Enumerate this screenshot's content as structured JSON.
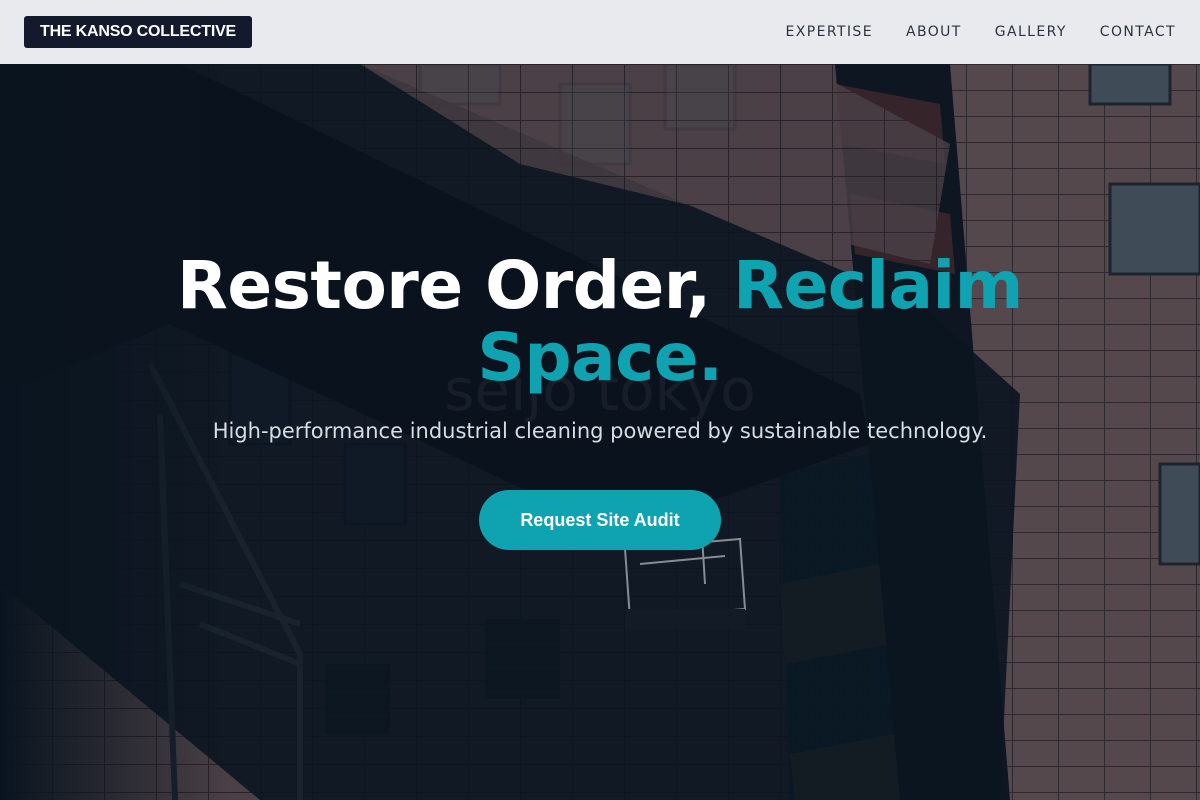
{
  "header": {
    "logo": "THE KANSO COLLECTIVE",
    "nav": [
      {
        "label": "EXPERTISE"
      },
      {
        "label": "ABOUT"
      },
      {
        "label": "GALLERY"
      },
      {
        "label": "CONTACT"
      }
    ]
  },
  "hero": {
    "headline_part1": "Restore Order,",
    "headline_accent": "Reclaim Space.",
    "subheadline": "High-performance industrial cleaning powered by sustainable technology.",
    "cta_label": "Request Site Audit",
    "background_sign_text": "seijo tokyo"
  },
  "colors": {
    "accent": "#0fa3b1",
    "logo_bg": "#121a2c",
    "header_bg": "#f0f2f4",
    "nav_text": "#2b3440"
  }
}
